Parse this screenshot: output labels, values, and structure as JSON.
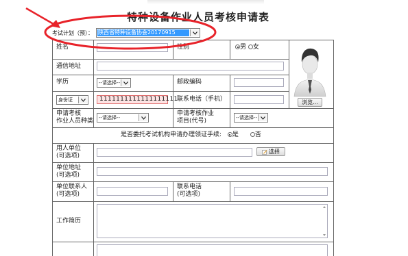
{
  "page": {
    "title": "特种设备作业人员考核申请表"
  },
  "plan": {
    "label": "考试计划（预）：",
    "selected": "陕西省特种设备协会20170915"
  },
  "form": {
    "name_label": "姓名",
    "gender_label": "性别",
    "gender_options": [
      "男",
      "女"
    ],
    "gender_selected": "男",
    "address_label": "通信地址",
    "education_label": "学历",
    "education_select": "--请选择--",
    "postcode_label": "邮政编码",
    "id_type_select": "身份证",
    "id_number": "1111111111111111111",
    "phone_label": "联系电话（手机）",
    "category_label_1": "申请考核",
    "category_label_2": "作业人员种类",
    "category_select": "--请选择--",
    "project_label_1": "申请考核作业",
    "project_label_2": "项目(代号)",
    "project_select": "--请选择--",
    "entrust_question": "是否委托考试机构申请办理领证手续:",
    "entrust_options": [
      "是",
      "否"
    ],
    "entrust_selected": "是",
    "employer_label_1": "用人单位",
    "employer_label_2": "(可选项)",
    "select_button": "选择",
    "employer_addr_label_1": "单位地址",
    "employer_addr_label_2": "(可选项)",
    "contact_label_1": "单位联系人",
    "contact_label_2": "(可选项)",
    "contact_phone_label_1": "联系电话",
    "contact_phone_label_2": "(可选项)",
    "resume_label": "工作简历"
  },
  "photo": {
    "browse_button": "浏览..."
  },
  "annotation": {
    "color": "#e8232a"
  }
}
